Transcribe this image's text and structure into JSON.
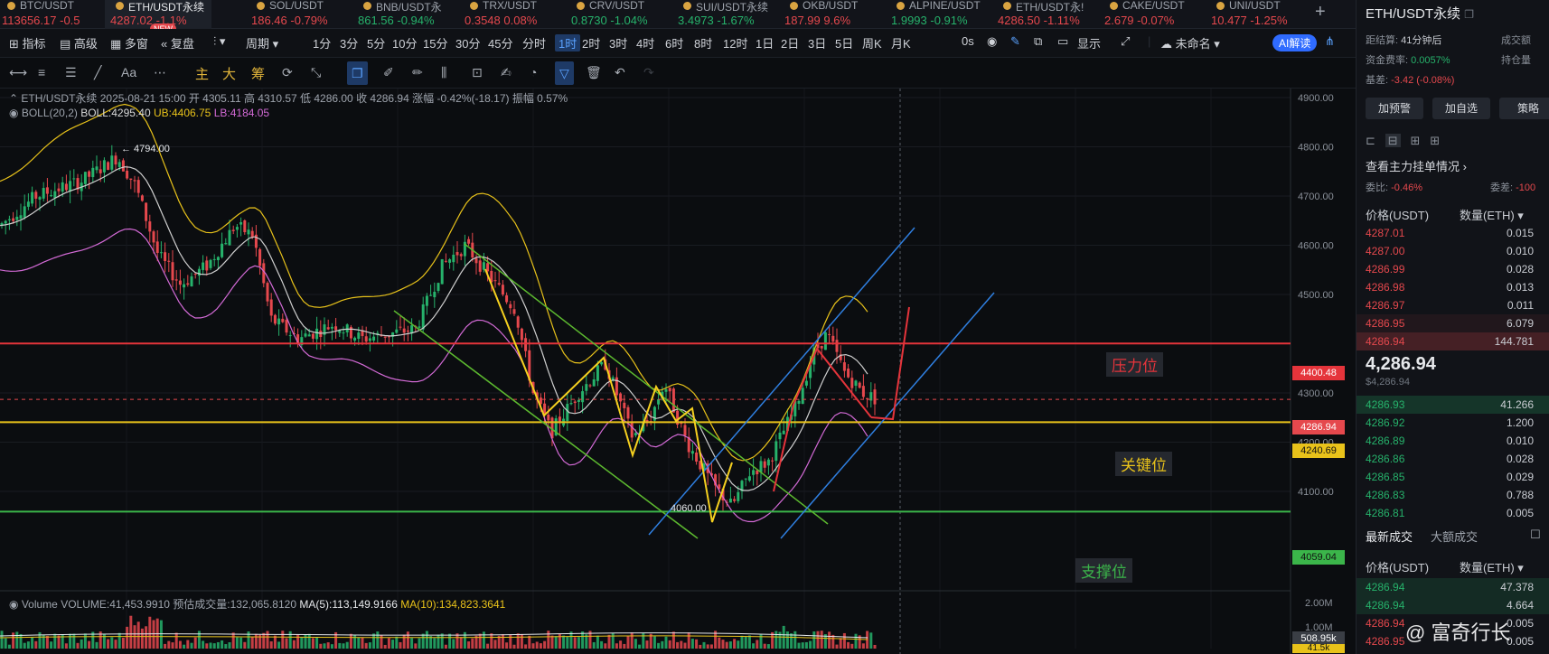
{
  "tabs": [
    {
      "sym": "BTC/USDT",
      "price": "113656.17",
      "chg": "-0.5",
      "dir": "down",
      "x": -4
    },
    {
      "sym": "ETH/USDT永续",
      "price": "4287.02",
      "chg": "-1.1%",
      "dir": "down",
      "x": 116,
      "active": true,
      "badge": "NEW"
    },
    {
      "sym": "SOL/USDT",
      "price": "186.46",
      "chg": "-0.79%",
      "dir": "down",
      "x": 272
    },
    {
      "sym": "BNB/USDT永",
      "price": "861.56",
      "chg": "-0.94%",
      "dir": "up",
      "x": 390
    },
    {
      "sym": "TRX/USDT",
      "price": "0.3548",
      "chg": "0.08%",
      "dir": "down",
      "x": 508
    },
    {
      "sym": "CRV/USDT",
      "price": "0.8730",
      "chg": "-1.04%",
      "dir": "up",
      "x": 626
    },
    {
      "sym": "SUI/USDT永续",
      "price": "3.4973",
      "chg": "-1.67%",
      "dir": "up",
      "x": 744
    },
    {
      "sym": "OKB/USDT",
      "price": "187.99",
      "chg": "9.6%",
      "dir": "down",
      "x": 862
    },
    {
      "sym": "ALPINE/USDT",
      "price": "1.9993",
      "chg": "-0.91%",
      "dir": "up",
      "x": 980
    },
    {
      "sym": "ETH/USDT永!",
      "price": "4286.50",
      "chg": "-1.11%",
      "dir": "down",
      "x": 1098
    },
    {
      "sym": "CAKE/USDT",
      "price": "2.679",
      "chg": "-0.07%",
      "dir": "down",
      "x": 1216
    },
    {
      "sym": "UNI/USDT",
      "price": "10.477",
      "chg": "-1.25%",
      "dir": "down",
      "x": 1334
    }
  ],
  "toolbar": {
    "indicators": "指标",
    "advanced": "高级",
    "multi": "多窗",
    "replay": "复盘",
    "period": "周期",
    "intervals": [
      "1分",
      "3分",
      "5分",
      "10分",
      "15分",
      "30分",
      "45分",
      "分时",
      "1时",
      "2时",
      "3时",
      "4时",
      "6时",
      "8时",
      "12时",
      "1日",
      "2日",
      "3日",
      "5日",
      "周K",
      "月K"
    ],
    "selected_interval": "1时",
    "zero_s": "0s",
    "display": "显示",
    "unnamed": "未命名",
    "ai": "AI解读"
  },
  "toolbar2": {
    "main": "主",
    "big": "大",
    "chips": "筹"
  },
  "chart": {
    "info": "ETH/USDT永续 2025-08-21 15:00 开 4305.11 高 4310.57 低 4286.00 收 4286.94 涨幅 -0.42%(-18.17) 振幅 0.57%",
    "boll_label": "BOLL(20,2)",
    "boll": "BOLL:4295.40",
    "ub": "UB:4406.75",
    "lb": "LB:4184.05",
    "volume_info": "Volume VOLUME:41,453.9910  预估成交量:132,065.8120",
    "ma5": "MA(5):113,149.9166",
    "ma10": "MA(10):134,823.3641",
    "high_mark": "← 4794.00",
    "low_mark": "4060.00",
    "levels": {
      "resistance": {
        "label": "压力位",
        "price": "4400.48",
        "color": "#e5343b"
      },
      "key": {
        "label": "关键位",
        "price": "4240.69",
        "color": "#e8c21a"
      },
      "support": {
        "label": "支撑位",
        "price": "4059.04",
        "color": "#3bb54a"
      },
      "current": {
        "price": "4286.94",
        "color": "#e5484d"
      }
    },
    "y_ticks": [
      "4900.00",
      "4800.00",
      "4700.00",
      "4600.00",
      "4500.00",
      "4300.00",
      "4200.00",
      "4100.00"
    ],
    "vol_ticks": [
      "2.00M",
      "1.00M"
    ],
    "vol_tag": "508.95k",
    "vol_tag2": "41.5k"
  },
  "side": {
    "title": "ETH/USDT永续",
    "settle_label": "距结算:",
    "settle_value": "41分钟后",
    "turnover_label": "成交额",
    "funding_label": "资金费率:",
    "funding_value": "0.0057%",
    "position_label": "持仓量",
    "basis_label": "基差:",
    "basis_value": "-3.42 (-0.08%)",
    "buttons": [
      "加预警",
      "加自选",
      "策略"
    ],
    "view_orders": "查看主力挂单情况 ›",
    "ratio_label": "委比:",
    "ratio_value": "-0.46%",
    "diff_label": "委差:",
    "diff_value": "-100",
    "col_price": "价格(USDT)",
    "col_qty": "数量(ETH)",
    "asks": [
      [
        "4287.01",
        "0.015"
      ],
      [
        "4287.00",
        "0.010"
      ],
      [
        "4286.99",
        "0.028"
      ],
      [
        "4286.98",
        "0.013"
      ],
      [
        "4286.97",
        "0.011"
      ],
      [
        "4286.95",
        "6.079"
      ],
      [
        "4286.94",
        "144.781"
      ]
    ],
    "last": "4,286.94",
    "last_usd": "$4,286.94",
    "bids": [
      [
        "4286.93",
        "41.266"
      ],
      [
        "4286.92",
        "1.200"
      ],
      [
        "4286.89",
        "0.010"
      ],
      [
        "4286.86",
        "0.028"
      ],
      [
        "4286.85",
        "0.029"
      ],
      [
        "4286.83",
        "0.788"
      ],
      [
        "4286.81",
        "0.005"
      ]
    ],
    "trades_tab": "最新成交",
    "big_trades_tab": "大额成交",
    "trades": [
      [
        "4286.94",
        "47.378"
      ],
      [
        "4286.94",
        "4.664"
      ],
      [
        "4286.94",
        "0.005"
      ],
      [
        "4286.95",
        "0.005"
      ]
    ]
  },
  "watermark": "@ 富奇行长"
}
